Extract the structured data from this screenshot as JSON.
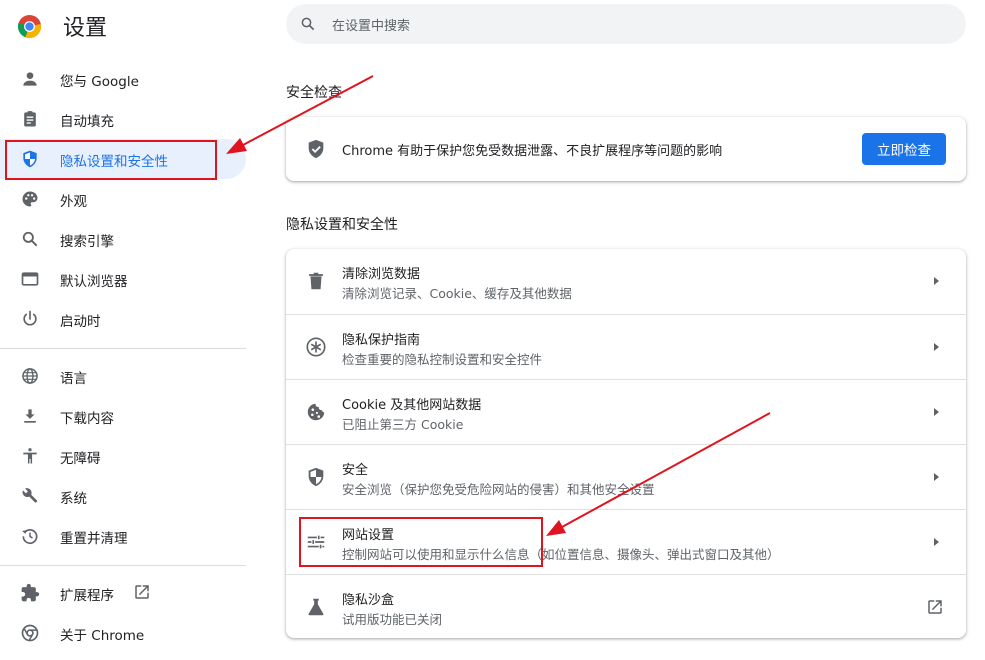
{
  "app": {
    "title": "设置"
  },
  "search": {
    "placeholder": "在设置中搜索"
  },
  "sidebar": {
    "items": [
      {
        "label": "您与 Google",
        "icon": "person-icon"
      },
      {
        "label": "自动填充",
        "icon": "clipboard-icon"
      },
      {
        "label": "隐私设置和安全性",
        "icon": "shield-icon",
        "active": true
      },
      {
        "label": "外观",
        "icon": "palette-icon"
      },
      {
        "label": "搜索引擎",
        "icon": "search-icon"
      },
      {
        "label": "默认浏览器",
        "icon": "browser-icon"
      },
      {
        "label": "启动时",
        "icon": "power-icon"
      },
      {
        "label": "语言",
        "icon": "globe-icon"
      },
      {
        "label": "下载内容",
        "icon": "download-icon"
      },
      {
        "label": "无障碍",
        "icon": "accessibility-icon"
      },
      {
        "label": "系统",
        "icon": "wrench-icon"
      },
      {
        "label": "重置并清理",
        "icon": "history-icon"
      },
      {
        "label": "扩展程序",
        "icon": "puzzle-icon"
      },
      {
        "label": "关于 Chrome",
        "icon": "chrome-icon"
      }
    ]
  },
  "safety_check": {
    "title": "安全检查",
    "text": "Chrome 有助于保护您免受数据泄露、不良扩展程序等问题的影响",
    "button_label": "立即检查"
  },
  "privacy": {
    "title": "隐私设置和安全性",
    "rows": [
      {
        "title": "清除浏览数据",
        "subtitle": "清除浏览记录、Cookie、缓存及其他数据",
        "icon": "trash-icon"
      },
      {
        "title": "隐私保护指南",
        "subtitle": "检查重要的隐私控制设置和安全控件",
        "icon": "privacy-guide-icon"
      },
      {
        "title": "Cookie 及其他网站数据",
        "subtitle": "已阻止第三方 Cookie",
        "icon": "cookie-icon"
      },
      {
        "title": "安全",
        "subtitle": "安全浏览（保护您免受危险网站的侵害）和其他安全设置",
        "icon": "security-shield-icon"
      },
      {
        "title": "网站设置",
        "subtitle": "控制网站可以使用和显示什么信息（如位置信息、摄像头、弹出式窗口及其他）",
        "icon": "tune-icon"
      },
      {
        "title": "隐私沙盒",
        "subtitle": "试用版功能已关闭",
        "icon": "flask-icon"
      }
    ]
  },
  "colors": {
    "accent": "#1a73e8",
    "annotation": "#e0141e",
    "active_bg": "#e8f0fe"
  }
}
